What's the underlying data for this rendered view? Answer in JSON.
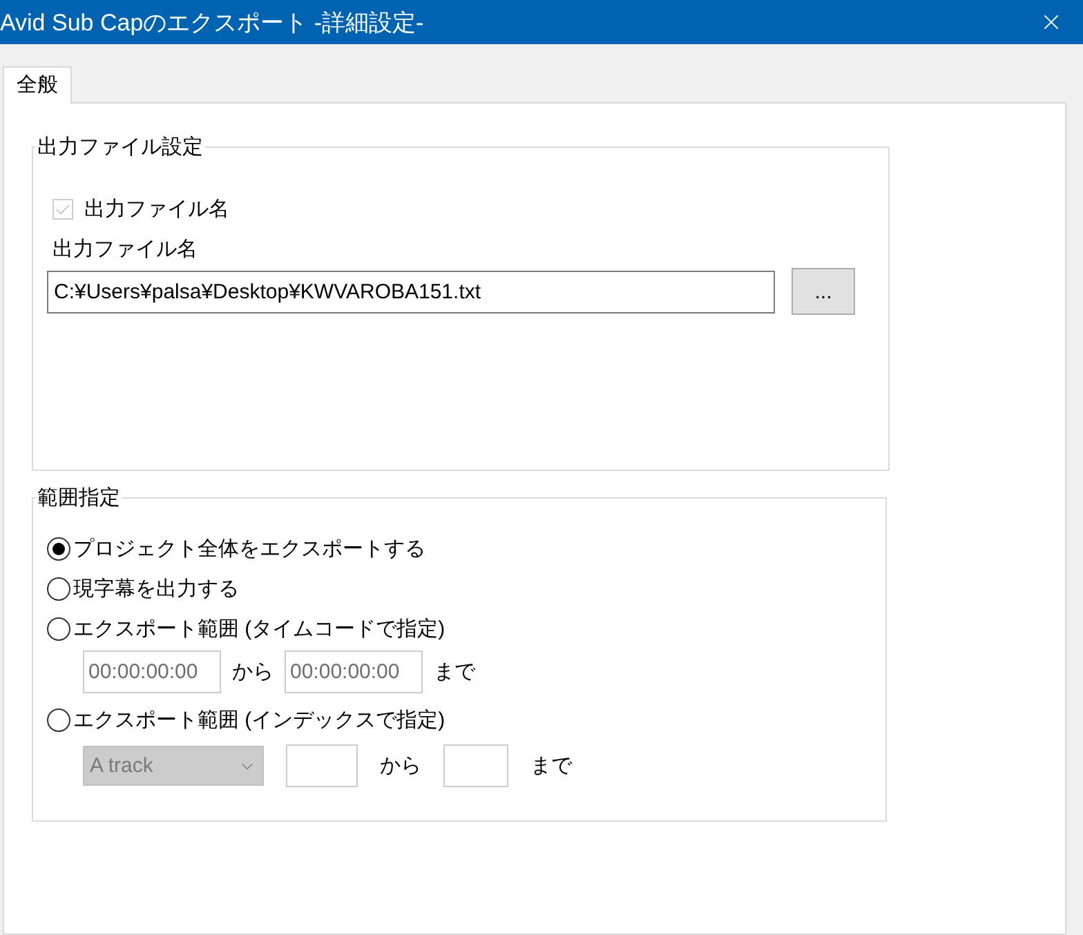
{
  "window": {
    "title": "Avid Sub Capのエクスポート -詳細設定-"
  },
  "tabs": [
    {
      "label": "全般",
      "selected": true
    }
  ],
  "output_group": {
    "legend": "出力ファイル設定",
    "checkbox": {
      "label": "出力ファイル名",
      "checked": true,
      "disabled": true
    },
    "field_label": "出力ファイル名",
    "path": {
      "value": "C:¥Users¥palsa¥Desktop¥KWVAROBA151.txt"
    },
    "browse_button": "..."
  },
  "range_group": {
    "legend": "範囲指定",
    "options": [
      {
        "kind": "radio",
        "label": "プロジェクト全体をエクスポートする",
        "selected": true
      },
      {
        "kind": "radio",
        "label": "現字幕を出力する",
        "selected": false
      },
      {
        "kind": "radio",
        "label": "エクスポート範囲 (タイムコードで指定)",
        "selected": false
      },
      {
        "kind": "timecode",
        "start": "00:00:00:00",
        "from": "から",
        "end": "00:00:00:00",
        "to": "まで",
        "disabled": true
      },
      {
        "kind": "radio",
        "label": "エクスポート範囲 (インデックスで指定)",
        "selected": false
      },
      {
        "kind": "index",
        "select": "A track",
        "from": "から",
        "to": "まで",
        "disabled": true
      }
    ]
  }
}
